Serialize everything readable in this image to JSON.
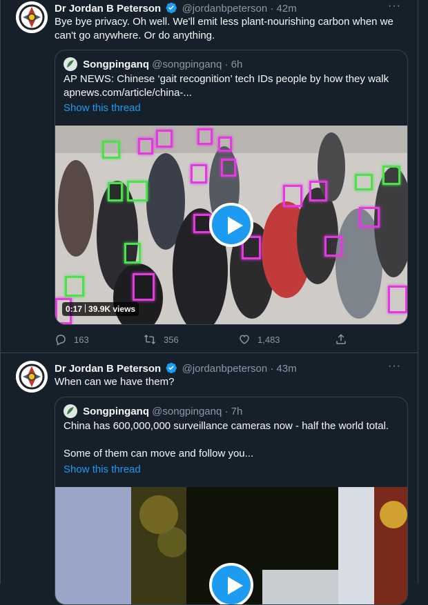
{
  "tweets": [
    {
      "author_name": "Dr Jordan B Peterson",
      "handle": "@jordanbpeterson",
      "time": "· 42m",
      "text": "Bye bye privacy. Oh well. We'll emit less plant-nourishing carbon when we can't go anywhere. Or do anything.",
      "quote": {
        "author_name": "Songpinganq",
        "handle": "@songpinganq",
        "time": "· 6h",
        "text": "AP NEWS: Chinese ‘gait recognition’ tech IDs people by how they walk apnews.com/article/china-...",
        "show_thread": "Show this thread",
        "video_duration": "0:17",
        "video_views": "39.9K views"
      },
      "actions": {
        "replies": "163",
        "retweets": "356",
        "likes": "1,483"
      }
    },
    {
      "author_name": "Dr Jordan B Peterson",
      "handle": "@jordanbpeterson",
      "time": "· 43m",
      "text": "When can we have them?",
      "quote": {
        "author_name": "Songpinganq",
        "handle": "@songpinganq",
        "time": "· 7h",
        "text_line1": "China has 600,000,000 surveillance cameras now - half the world total.",
        "text_line2": "Some of them can move and follow you...",
        "show_thread": "Show this thread"
      }
    }
  ],
  "colors": {
    "background": "#15202b",
    "border": "#38444d",
    "accent": "#1d9bf0",
    "muted_text": "#8b98a5",
    "face_box_pink": "#e33ae0",
    "face_box_green": "#4ce04a"
  },
  "icons": [
    "more-icon",
    "verified-badge-icon",
    "reply-icon",
    "retweet-icon",
    "like-icon",
    "share-icon",
    "play-icon"
  ]
}
